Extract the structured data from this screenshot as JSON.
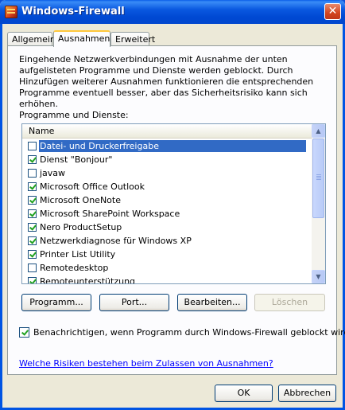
{
  "window": {
    "title": "Windows-Firewall",
    "close_glyph": "✕",
    "icon": "firewall-icon"
  },
  "tabs": [
    {
      "label": "Allgemein",
      "active": false
    },
    {
      "label": "Ausnahmen",
      "active": true
    },
    {
      "label": "Erweitert",
      "active": false
    }
  ],
  "panel": {
    "intro_text": "Eingehende Netzwerkverbindungen mit Ausnahme der unten aufgelisteten Programme und Dienste werden geblockt. Durch Hinzufügen weiterer Ausnahmen funktionieren die entsprechenden Programme eventuell besser, aber das Sicherheitsrisiko kann sich erhöhen.",
    "programs_label": "Programme und Dienste:",
    "list_header": "Name",
    "items": [
      {
        "label": "Datei- und Druckerfreigabe",
        "checked": false,
        "selected": true
      },
      {
        "label": "Dienst \"Bonjour\"",
        "checked": true,
        "selected": false
      },
      {
        "label": "javaw",
        "checked": false,
        "selected": false
      },
      {
        "label": "Microsoft Office Outlook",
        "checked": true,
        "selected": false
      },
      {
        "label": "Microsoft OneNote",
        "checked": true,
        "selected": false
      },
      {
        "label": "Microsoft SharePoint Workspace",
        "checked": true,
        "selected": false
      },
      {
        "label": "Nero ProductSetup",
        "checked": true,
        "selected": false
      },
      {
        "label": "Netzwerkdiagnose für Windows XP",
        "checked": true,
        "selected": false
      },
      {
        "label": "Printer List Utility",
        "checked": true,
        "selected": false
      },
      {
        "label": "Remotedesktop",
        "checked": false,
        "selected": false
      },
      {
        "label": "Remoteunterstützung",
        "checked": true,
        "selected": false
      }
    ],
    "buttons": {
      "add_program": "Programm...",
      "add_port": "Port...",
      "edit": "Bearbeiten...",
      "delete": "Löschen"
    },
    "notify_label": "Benachrichtigen, wenn Programm durch Windows-Firewall geblockt wird",
    "notify_checked": true,
    "risk_link": "Welche Risiken bestehen beim Zulassen von Ausnahmen?"
  },
  "footer": {
    "ok": "OK",
    "cancel": "Abbrechen"
  }
}
